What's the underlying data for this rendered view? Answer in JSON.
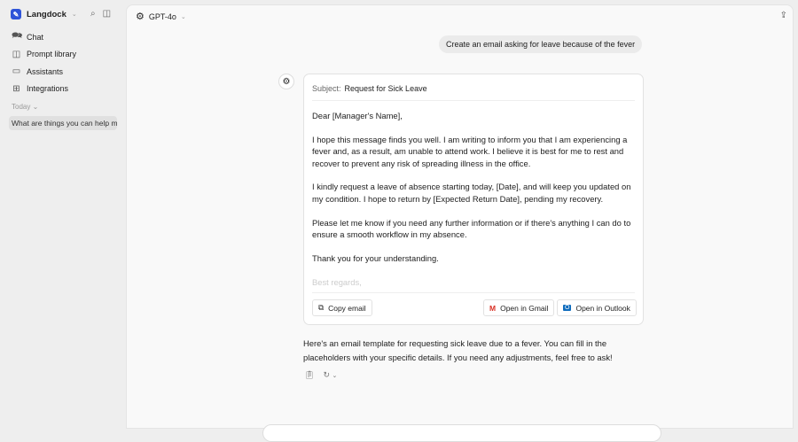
{
  "sidebar": {
    "brand": "Langdock",
    "items": [
      {
        "label": "Chat",
        "icon": "chat-icon"
      },
      {
        "label": "Prompt library",
        "icon": "book-icon"
      },
      {
        "label": "Assistants",
        "icon": "assistant-icon"
      },
      {
        "label": "Integrations",
        "icon": "integrations-icon"
      }
    ],
    "section": "Today",
    "history": [
      "What are things you can help me"
    ]
  },
  "header": {
    "model": "GPT-4o"
  },
  "chat": {
    "user_message": "Create an email asking for leave because of the fever",
    "email": {
      "subject_label": "Subject:",
      "subject": "Request for Sick Leave",
      "paragraphs": [
        "Dear [Manager's Name],",
        "I hope this message finds you well. I am writing to inform you that I am experiencing a fever and, as a result, am unable to attend work. I believe it is best for me to rest and recover to prevent any risk of spreading illness in the office.",
        "I kindly request a leave of absence starting today, [Date], and will keep you updated on my condition. I hope to return by [Expected Return Date], pending my recovery.",
        "Please let me know if you need any further information or if there's anything I can do to ensure a smooth workflow in my absence.",
        "Thank you for your understanding.",
        "Best regards,"
      ],
      "copy": "Copy email",
      "gmail": "Open in Gmail",
      "outlook": "Open in Outlook"
    },
    "reply": "Here's an email template for requesting sick leave due to a fever. You can fill in the placeholders with your specific details. If you need any adjustments, feel free to ask!"
  }
}
